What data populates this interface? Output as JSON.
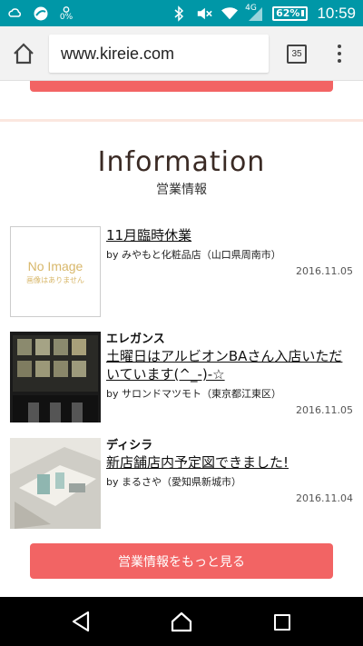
{
  "status_bar": {
    "time": "10:59",
    "battery": "62%",
    "network": "4G",
    "data_percent": "0%"
  },
  "browser": {
    "url": "www.kireie.com",
    "tab_count": "35"
  },
  "section": {
    "title": "Information",
    "subtitle": "営業情報"
  },
  "items": [
    {
      "category": "",
      "title": "11月臨時休業",
      "by": "by みやもと化粧品店（山口県周南市）",
      "date": "2016.11.05",
      "no_image_en": "No Image",
      "no_image_jp": "画像はありません"
    },
    {
      "category": "エレガンス",
      "title": "土曜日はアルビオンBAさん入店いただいています(^_-)-☆",
      "by": "by サロンドマツモト（東京都江東区）",
      "date": "2016.11.05"
    },
    {
      "category": "ディシラ",
      "title": "新店舗店内予定図できました!",
      "by": "by まるさや（愛知県新城市）",
      "date": "2016.11.04"
    }
  ],
  "more_button": "営業情報をもっと見る",
  "colors": {
    "status_bar": "#0097a7",
    "accent_button": "#f26464",
    "title_text": "#3a2a24",
    "no_image_text": "#d8b76a"
  }
}
